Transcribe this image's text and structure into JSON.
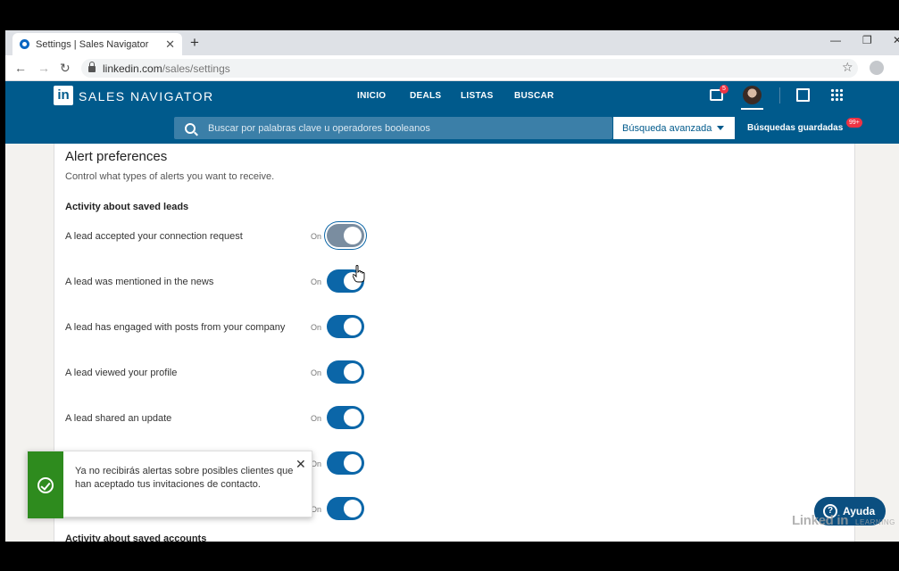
{
  "browser": {
    "tab_title": "Settings | Sales Navigator",
    "tab_close": "✕",
    "new_tab": "+",
    "url_host": "linkedin.com",
    "url_path": "/sales/settings",
    "minimize": "—",
    "maximize": "❐",
    "close": "✕"
  },
  "header": {
    "logo_in": "in",
    "product": "SALES NAVIGATOR",
    "nav": [
      "INICIO",
      "DEALS",
      "LISTAS",
      "BUSCAR"
    ],
    "messages_badge": "5",
    "search_placeholder": "Buscar por palabras clave u operadores booleanos",
    "advanced_search": "Búsqueda avanzada",
    "saved_searches": "Búsquedas guardadas",
    "saved_badge": "99+"
  },
  "settings": {
    "title": "Alert preferences",
    "description": "Control what types of alerts you want to receive.",
    "group_leads": "Activity about saved leads",
    "on_label": "On",
    "rows": [
      {
        "label": "A lead accepted your connection request",
        "state": "On"
      },
      {
        "label": "A lead was mentioned in the news",
        "state": "On"
      },
      {
        "label": "A lead has engaged with posts from your company",
        "state": "On"
      },
      {
        "label": "A lead viewed your profile",
        "state": "On"
      },
      {
        "label": "A lead shared an update",
        "state": "On"
      }
    ],
    "group_accounts": "Activity about saved accounts"
  },
  "toast": {
    "message": "Ya no recibirás alertas sobre posibles clientes que han aceptado tus invitaciones de contacto.",
    "close": "✕"
  },
  "help": {
    "label": "Ayuda",
    "q": "?"
  },
  "watermark": {
    "brand": "Linked in",
    "sub": "LEARNING"
  },
  "colors": {
    "brand": "#005a8c",
    "toggle_on": "#0b66a8",
    "toast_success": "#2e8b1e"
  }
}
